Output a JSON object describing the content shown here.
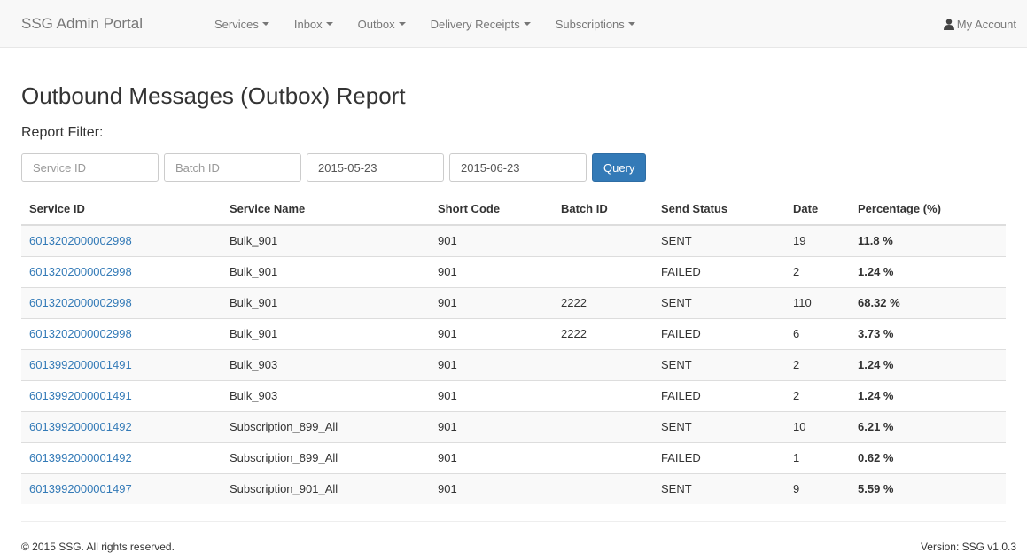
{
  "navbar": {
    "brand": "SSG Admin Portal",
    "menus": [
      "Services",
      "Inbox",
      "Outbox",
      "Delivery Receipts",
      "Subscriptions"
    ],
    "account_label": "My Account"
  },
  "page": {
    "title": "Outbound Messages (Outbox) Report",
    "filter_label": "Report Filter:"
  },
  "filter": {
    "service_id_placeholder": "Service ID",
    "batch_id_placeholder": "Batch ID",
    "start_date": "2015-05-23",
    "end_date": "2015-06-23",
    "query_label": "Query"
  },
  "table": {
    "columns": [
      "Service ID",
      "Service Name",
      "Short Code",
      "Batch ID",
      "Send Status",
      "Date",
      "Percentage (%)"
    ],
    "rows": [
      [
        "6013202000002998",
        "Bulk_901",
        "901",
        "",
        "SENT",
        "19",
        "11.8 %"
      ],
      [
        "6013202000002998",
        "Bulk_901",
        "901",
        "",
        "FAILED",
        "2",
        "1.24 %"
      ],
      [
        "6013202000002998",
        "Bulk_901",
        "901",
        "2222",
        "SENT",
        "110",
        "68.32 %"
      ],
      [
        "6013202000002998",
        "Bulk_901",
        "901",
        "2222",
        "FAILED",
        "6",
        "3.73 %"
      ],
      [
        "6013992000001491",
        "Bulk_903",
        "901",
        "",
        "SENT",
        "2",
        "1.24 %"
      ],
      [
        "6013992000001491",
        "Bulk_903",
        "901",
        "",
        "FAILED",
        "2",
        "1.24 %"
      ],
      [
        "6013992000001492",
        "Subscription_899_All",
        "901",
        "",
        "SENT",
        "10",
        "6.21 %"
      ],
      [
        "6013992000001492",
        "Subscription_899_All",
        "901",
        "",
        "FAILED",
        "1",
        "0.62 %"
      ],
      [
        "6013992000001497",
        "Subscription_901_All",
        "901",
        "",
        "SENT",
        "9",
        "5.59 %"
      ]
    ]
  },
  "footer": {
    "copyright": "© 2015 SSG. All rights reserved.",
    "version": "Version: SSG  v1.0.3"
  },
  "colors": {
    "link": "#337ab7",
    "primary_button": "#337ab7",
    "navbar_bg": "#f8f8f8"
  },
  "icons": {
    "account": "user-icon",
    "menu_toggle": "caret-down-icon"
  }
}
